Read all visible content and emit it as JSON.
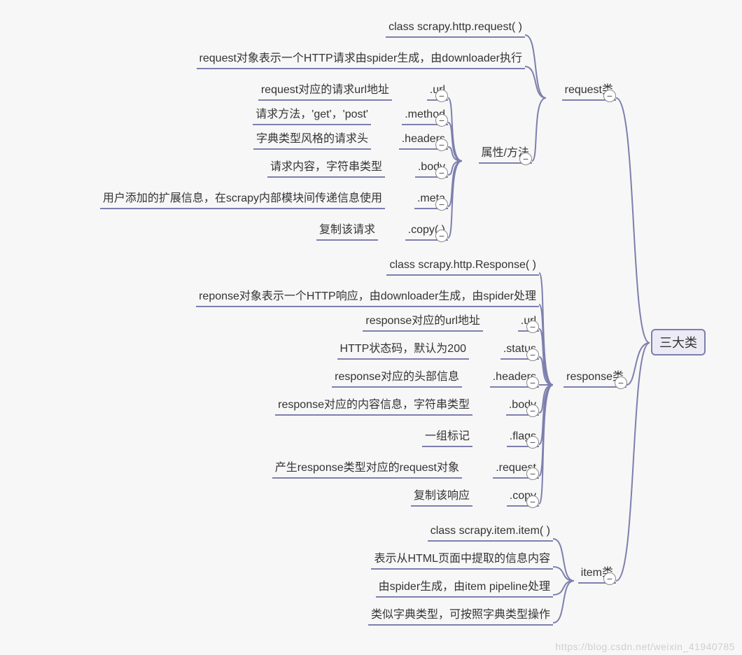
{
  "root": {
    "label": "三大类"
  },
  "branches": {
    "request": {
      "label": "request类",
      "desc1": "class scrapy.http.request( )",
      "desc2": "request对象表示一个HTTP请求由spider生成，由downloader执行",
      "attrs_label": "属性/方法",
      "attrs": [
        {
          "key": ".url",
          "desc": "request对应的请求url地址"
        },
        {
          "key": ".method",
          "desc": "请求方法，'get'，'post'"
        },
        {
          "key": ".headers",
          "desc": "字典类型风格的请求头"
        },
        {
          "key": ".body",
          "desc": "请求内容，字符串类型"
        },
        {
          "key": ".meta",
          "desc": "用户添加的扩展信息，在scrapy内部模块间传递信息使用"
        },
        {
          "key": ".copy( )",
          "desc": "复制该请求"
        }
      ]
    },
    "response": {
      "label": "response类",
      "desc1": "class scrapy.http.Response( )",
      "desc2": "reponse对象表示一个HTTP响应，由downloader生成，由spider处理",
      "attrs": [
        {
          "key": ".url",
          "desc": "response对应的url地址"
        },
        {
          "key": ".status",
          "desc": "HTTP状态码，默认为200"
        },
        {
          "key": ".headers",
          "desc": "response对应的头部信息"
        },
        {
          "key": ".body",
          "desc": "response对应的内容信息，字符串类型"
        },
        {
          "key": ".flags",
          "desc": "一组标记"
        },
        {
          "key": ".request",
          "desc": "产生response类型对应的request对象"
        },
        {
          "key": ".copy",
          "desc": "复制该响应"
        }
      ]
    },
    "item": {
      "label": "item类",
      "lines": [
        "class scrapy.item.item( )",
        "表示从HTML页面中提取的信息内容",
        "由spider生成，由item pipeline处理",
        "类似字典类型，可按照字典类型操作"
      ]
    }
  },
  "watermark": "https://blog.csdn.net/weixin_41940785"
}
